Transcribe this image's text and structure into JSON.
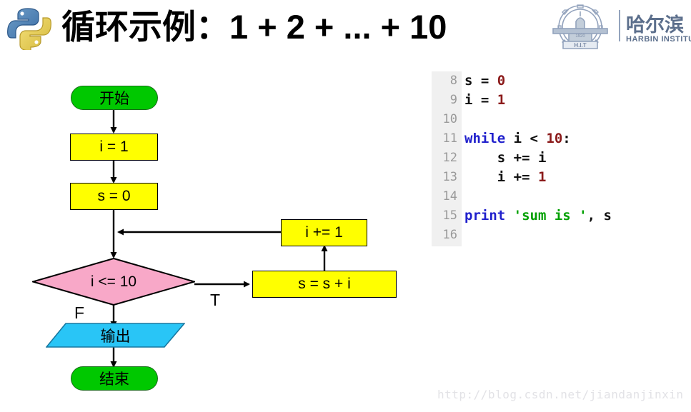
{
  "header": {
    "title": "循环示例：1 + 2 + ... + 10",
    "python_logo_alt": "python-logo",
    "hit_logo": {
      "cn_name": "哈尔滨",
      "en_name": "HARBIN INSTITU",
      "crest_abbr": "H.I.T",
      "crest_year": "1920"
    }
  },
  "flowchart": {
    "nodes": [
      {
        "id": "start",
        "label": "开始",
        "shape": "terminator",
        "fill": "#00c800"
      },
      {
        "id": "init_i",
        "label": "i = 1",
        "shape": "process",
        "fill": "#ffff00"
      },
      {
        "id": "init_s",
        "label": "s = 0",
        "shape": "process",
        "fill": "#ffff00"
      },
      {
        "id": "cond",
        "label": "i <= 10",
        "shape": "decision",
        "fill": "#f8a8c8"
      },
      {
        "id": "sum",
        "label": "s = s + i",
        "shape": "process",
        "fill": "#ffff00"
      },
      {
        "id": "incr",
        "label": "i += 1",
        "shape": "process",
        "fill": "#ffff00"
      },
      {
        "id": "output",
        "label": "输出",
        "shape": "parallelogram",
        "fill": "#29c5f6"
      },
      {
        "id": "end",
        "label": "结束",
        "shape": "terminator",
        "fill": "#00c800"
      }
    ],
    "branch_labels": {
      "true": "T",
      "false": "F"
    }
  },
  "code": {
    "language": "python",
    "lines": [
      {
        "number": "8",
        "tokens": [
          {
            "t": "s = ",
            "c": "plain"
          },
          {
            "t": "0",
            "c": "num"
          }
        ]
      },
      {
        "number": "9",
        "tokens": [
          {
            "t": "i = ",
            "c": "plain"
          },
          {
            "t": "1",
            "c": "num"
          }
        ]
      },
      {
        "number": "10",
        "tokens": []
      },
      {
        "number": "11",
        "tokens": [
          {
            "t": "while",
            "c": "kw"
          },
          {
            "t": " i < ",
            "c": "plain"
          },
          {
            "t": "10",
            "c": "num"
          },
          {
            "t": ":",
            "c": "plain"
          }
        ]
      },
      {
        "number": "12",
        "tokens": [
          {
            "t": "    s += i",
            "c": "plain"
          }
        ]
      },
      {
        "number": "13",
        "tokens": [
          {
            "t": "    i += ",
            "c": "plain"
          },
          {
            "t": "1",
            "c": "num"
          }
        ]
      },
      {
        "number": "14",
        "tokens": []
      },
      {
        "number": "15",
        "tokens": [
          {
            "t": "print",
            "c": "kw"
          },
          {
            "t": " ",
            "c": "plain"
          },
          {
            "t": "'sum is '",
            "c": "str"
          },
          {
            "t": ", s",
            "c": "plain"
          }
        ]
      },
      {
        "number": "16",
        "tokens": []
      }
    ]
  },
  "watermark": {
    "url": "http://blog.csdn.net/jiandanjinxin"
  },
  "colors": {
    "terminator": "#00c800",
    "process": "#ffff00",
    "decision": "#f8a8c8",
    "io": "#29c5f6",
    "keyword": "#2020cc",
    "number": "#8b1a1a",
    "string": "#00a000"
  }
}
